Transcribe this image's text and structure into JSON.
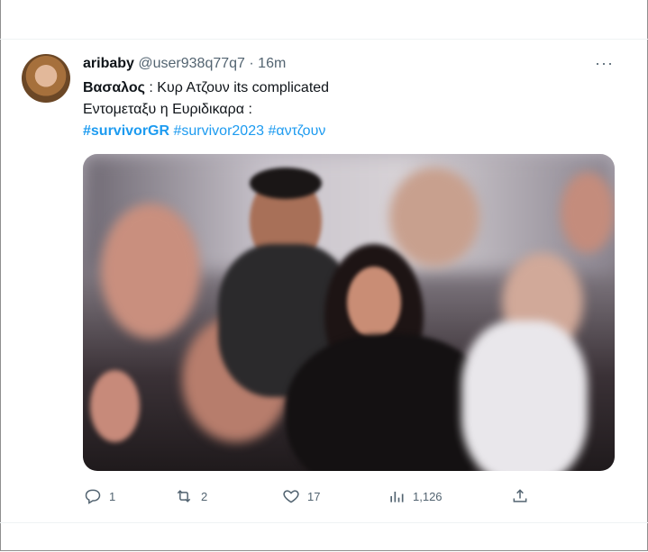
{
  "tweet": {
    "display_name": "aribaby",
    "handle": "@user938q77q7",
    "separator": "·",
    "time": "16m",
    "more_label": "···",
    "line1_bold": "Βασαλος",
    "line1_rest": " : Κυρ Ατζουν its complicated",
    "line2": "Εντομεταξυ η Ευριδικαρα :",
    "hashtags": [
      "#survivorGR",
      "#survivor2023",
      "#αντζουν"
    ]
  },
  "actions": {
    "replies": "1",
    "retweets": "2",
    "likes": "17",
    "views": "1,126"
  },
  "icons": {
    "reply": "reply-icon",
    "retweet": "retweet-icon",
    "like": "heart-icon",
    "views": "views-icon",
    "share": "share-icon"
  },
  "colors": {
    "link": "#1d9bf0",
    "secondary_text": "#536471",
    "primary_text": "#0f1419"
  }
}
